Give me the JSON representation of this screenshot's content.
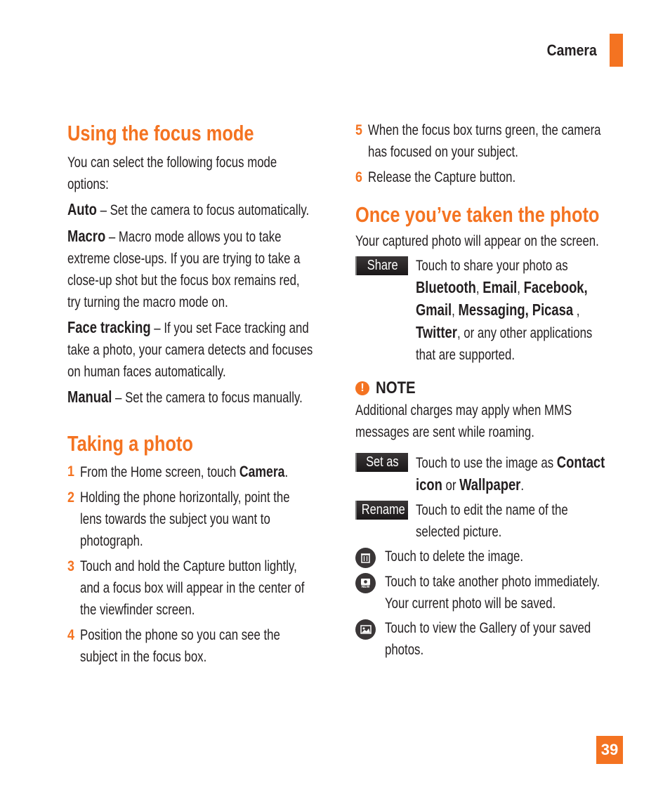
{
  "header": {
    "title": "Camera",
    "accent_color": "#f47321"
  },
  "left": {
    "focus_mode": {
      "title": "Using the focus mode",
      "intro_l1": "You can select the following focus mode",
      "intro_l2": "options:",
      "options": [
        {
          "label": "Auto",
          "lines": [
            " – Set the camera to focus automatically."
          ]
        },
        {
          "label": "Macro",
          "lines": [
            " – Macro mode allows you to take",
            "extreme close-ups. If you are trying to take a",
            "close-up shot but the focus box remains red,",
            "try turning the macro mode on."
          ]
        },
        {
          "label": "Face tracking",
          "lines": [
            " – If you set Face tracking and",
            "take a photo, your camera detects and focuses",
            "on human faces automatically."
          ]
        },
        {
          "label": "Manual",
          "lines": [
            " – Set the camera to focus manually."
          ]
        }
      ]
    },
    "taking_photo": {
      "title": "Taking a photo",
      "steps": [
        {
          "num": "1",
          "pre": "From the Home screen, touch ",
          "bold": "Camera",
          "post": "."
        },
        {
          "num": "2",
          "l1": "Holding the phone horizontally, point the",
          "l2": "lens towards the subject you want to",
          "l3": "photograph."
        },
        {
          "num": "3",
          "l1": "Touch and hold the Capture button lightly,",
          "l2": "and a focus box will appear in the center of",
          "l3": "the viewfinder screen."
        },
        {
          "num": "4",
          "l1": "Position the phone so you can see the",
          "l2": "subject in the focus box."
        }
      ]
    }
  },
  "right": {
    "steps": [
      {
        "num": "5",
        "l1": "When the focus box turns green, the camera",
        "l2": "has focused on your subject."
      },
      {
        "num": "6",
        "l1": "Release the Capture button."
      }
    ],
    "after_photo": {
      "title": "Once you’ve taken the photo",
      "intro": "Your captured photo will appear on the screen.",
      "share": {
        "badge": "Share",
        "l1": "Touch to share your photo as",
        "apps": [
          "Bluetooth",
          "Email",
          "Facebook,",
          "Gmail",
          "Messaging, Picasa",
          "Twitter"
        ],
        "sep": ",",
        "sep_space": " ,",
        "tail": ", or any other applications",
        "l4": "that are supported."
      },
      "note": {
        "icon": "!",
        "title": "NOTE",
        "l1": "Additional charges may apply when MMS",
        "l2": "messages are sent while roaming."
      },
      "set_as": {
        "badge": "Set as",
        "pre": "Touch to use the image as ",
        "bold1": "Contact",
        "bold1b": "icon",
        "mid": " or ",
        "bold2": "Wallpaper",
        "post": "."
      },
      "rename": {
        "badge": "Rename",
        "l1": "Touch to edit the name of the",
        "l2": "selected picture."
      },
      "delete": {
        "icon": "trash-icon",
        "text": "Touch to delete the image."
      },
      "new_photo": {
        "icon": "new-photo-icon",
        "icon_label": "NEW",
        "l1": "Touch to take another photo immediately.",
        "l2": "Your current photo will be saved."
      },
      "gallery": {
        "icon": "gallery-icon",
        "l1": "Touch to view the Gallery of your saved",
        "l2": "photos."
      }
    }
  },
  "page_number": "39"
}
